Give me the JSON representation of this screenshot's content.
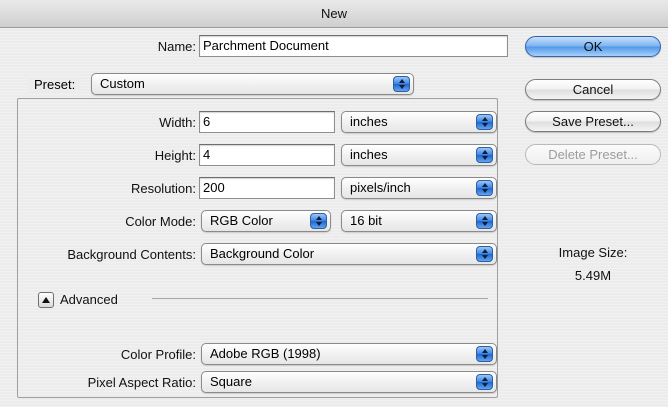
{
  "window": {
    "title": "New"
  },
  "name": {
    "label": "Name:",
    "value": "Parchment Document"
  },
  "preset": {
    "label": "Preset:",
    "value": "Custom"
  },
  "width": {
    "label": "Width:",
    "value": "6",
    "unit": "inches"
  },
  "height": {
    "label": "Height:",
    "value": "4",
    "unit": "inches"
  },
  "resolution": {
    "label": "Resolution:",
    "value": "200",
    "unit": "pixels/inch"
  },
  "color_mode": {
    "label": "Color Mode:",
    "value": "RGB Color",
    "depth": "16 bit"
  },
  "background": {
    "label": "Background Contents:",
    "value": "Background Color"
  },
  "advanced": {
    "label": "Advanced"
  },
  "color_profile": {
    "label": "Color Profile:",
    "value": "Adobe RGB (1998)"
  },
  "pixel_aspect": {
    "label": "Pixel Aspect Ratio:",
    "value": "Square"
  },
  "buttons": {
    "ok": "OK",
    "cancel": "Cancel",
    "save_preset": "Save Preset...",
    "delete_preset": "Delete Preset..."
  },
  "image_size": {
    "label": "Image Size:",
    "value": "5.49M"
  }
}
